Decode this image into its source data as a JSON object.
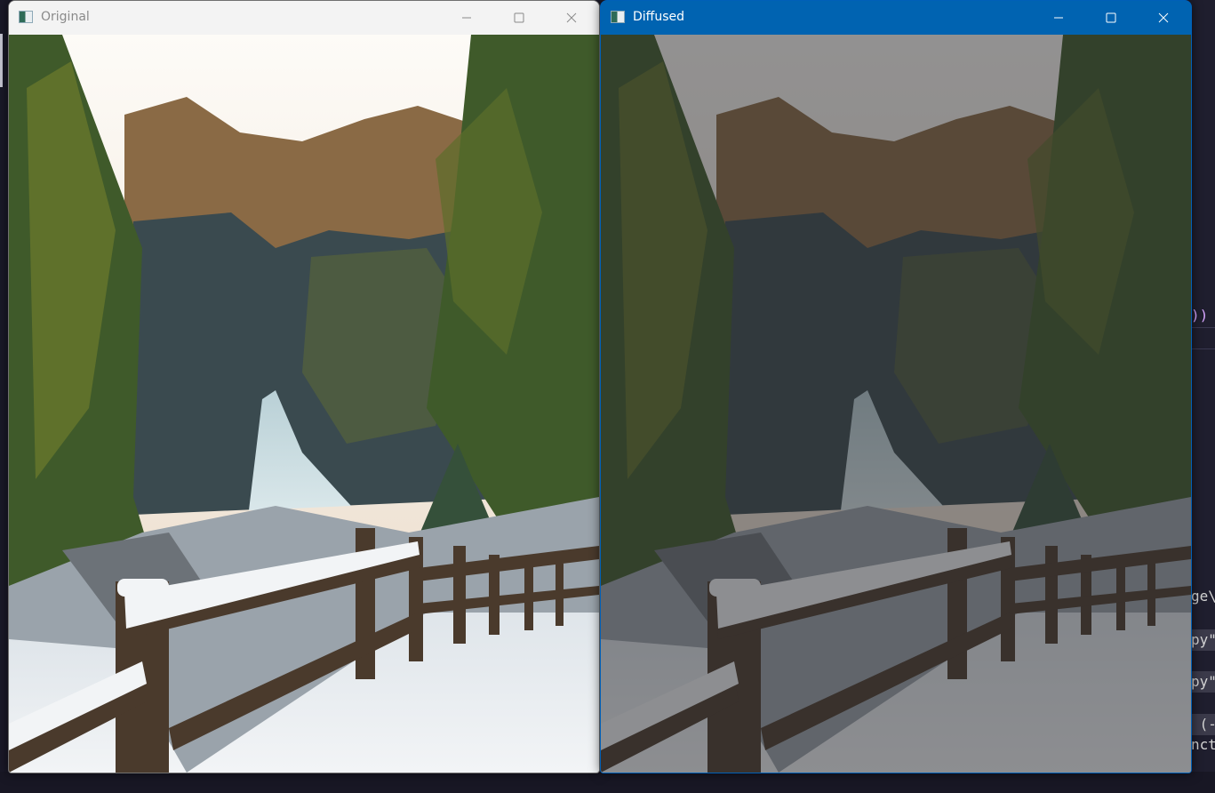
{
  "windows": {
    "original": {
      "title": "Original",
      "icon": "app-window-icon",
      "controls": {
        "minimize": "minimize-icon",
        "maximize": "maximize-icon",
        "close": "close-icon"
      },
      "active": false
    },
    "diffused": {
      "title": "Diffused",
      "icon": "app-window-icon",
      "controls": {
        "minimize": "minimize-icon",
        "maximize": "maximize-icon",
        "close": "close-icon"
      },
      "active": true,
      "accent_color": "#0063b1"
    }
  },
  "background_editor": {
    "code_fragments": [
      {
        "text": "))"
      },
      {
        "text": "ge\\"
      },
      {
        "text": "py\""
      },
      {
        "text": "py\""
      },
      {
        "text": " (-"
      },
      {
        "text": "nct"
      }
    ]
  },
  "image": {
    "subject": "snowy forest waterfall with wooden fence",
    "colors": {
      "sky": "#fdfbf7",
      "foliage": "#3f5a2a",
      "rock": "#3a4a4f",
      "snow": "#f2f4f6",
      "wood": "#4a3a2c",
      "waterfall": "#d9e7ea"
    }
  }
}
